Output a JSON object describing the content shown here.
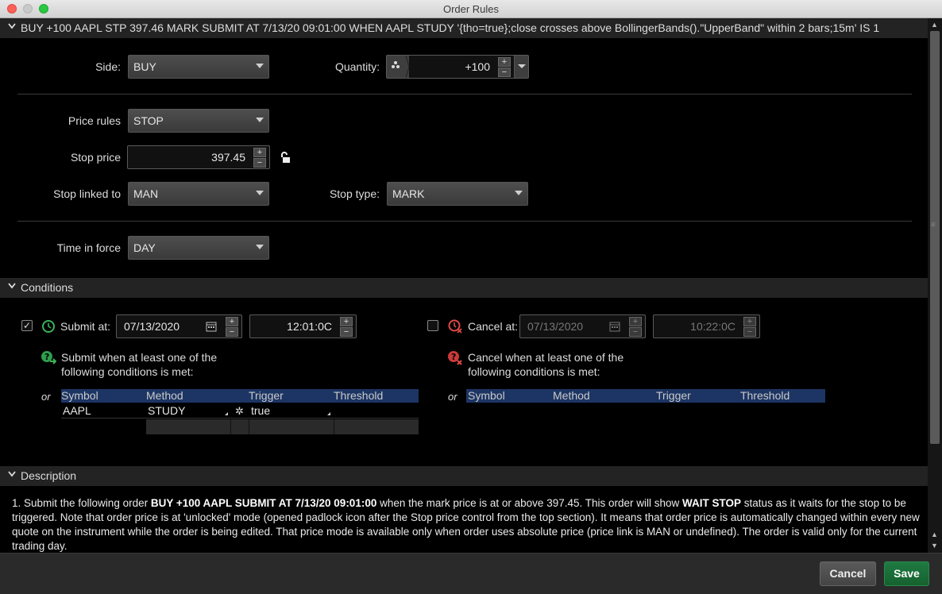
{
  "window": {
    "title": "Order Rules"
  },
  "order_header": {
    "summary": "BUY +100 AAPL STP 397.46 MARK SUBMIT AT 7/13/20 09:01:00 WHEN AAPL STUDY '{tho=true};close crosses above BollingerBands().\"UpperBand\" within 2 bars;15m' IS 1"
  },
  "order": {
    "side_label": "Side:",
    "side_value": "BUY",
    "quantity_label": "Quantity:",
    "quantity_value": "+100",
    "price_rules_label": "Price rules",
    "price_rules_value": "STOP",
    "stop_price_label": "Stop price",
    "stop_price_value": "397.45",
    "stop_linked_label": "Stop linked to",
    "stop_linked_value": "MAN",
    "stop_type_label": "Stop type:",
    "stop_type_value": "MARK",
    "tif_label": "Time in force",
    "tif_value": "DAY"
  },
  "conditions": {
    "header": "Conditions",
    "submit": {
      "checked": true,
      "label": "Submit at:",
      "date": "07/13/2020",
      "time": "12:01:0C",
      "hint_line1": "Submit when at least one of the",
      "hint_line2": "following conditions is met:",
      "or_label": "or",
      "columns": [
        "Symbol",
        "Method",
        "Trigger",
        "Threshold"
      ],
      "row": {
        "symbol": "AAPL",
        "method": "STUDY",
        "trigger": "true"
      }
    },
    "cancel": {
      "checked": false,
      "label": "Cancel at:",
      "date": "07/13/2020",
      "time": "10:22:0C",
      "hint_line1": "Cancel when at least one of the",
      "hint_line2": "following conditions is met:",
      "or_label": "or",
      "columns": [
        "Symbol",
        "Method",
        "Trigger",
        "Threshold"
      ]
    }
  },
  "description": {
    "header": "Description",
    "p1_a": "1. Submit the following order ",
    "p1_b": "BUY +100 AAPL SUBMIT AT 7/13/20 09:01:00",
    "p1_c": " when the mark price is at or above 397.45. This order will show ",
    "p1_d": "WAIT STOP",
    "p1_e": " status as it waits for the stop to be triggered. Note that order price is at 'unlocked' mode (opened padlock icon after the Stop price control from the top section). It means that order price is automatically changed within every new quote on the instrument while the order is being edited. That price mode is available only when order uses absolute price (price link is MAN or undefined). The order is valid only for the current trading day."
  },
  "footer": {
    "cancel_label": "Cancel",
    "save_label": "Save"
  }
}
